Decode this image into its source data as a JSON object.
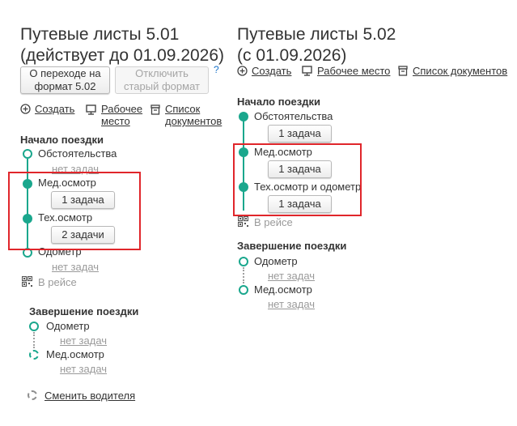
{
  "left": {
    "title_line1": "Путевые листы 5.01",
    "title_line2": "(действует до 01.09.2026)",
    "buttons": {
      "about_label": "О переходе на\nформат 5.02",
      "disable_label": "Отключить\nстарый формат",
      "help": "?"
    },
    "actions": {
      "create": "Создать",
      "workplace": "Рабочее\nместо",
      "doclist": "Список\nдокументов"
    },
    "start": {
      "heading": "Начало поездки",
      "steps": [
        {
          "label": "Обстоятельства",
          "task": "нет задач"
        },
        {
          "label": "Мед.осмотр",
          "task": "1 задача"
        },
        {
          "label": "Тех.осмотр",
          "task": "2 задачи"
        },
        {
          "label": "Одометр",
          "task": "нет задач"
        }
      ],
      "in_trip": "В рейсе"
    },
    "finish": {
      "heading": "Завершение поездки",
      "steps": [
        {
          "label": "Одометр",
          "task": "нет задач"
        },
        {
          "label": "Мед.осмотр",
          "task": "нет задач"
        }
      ]
    },
    "change_driver": "Сменить водителя"
  },
  "right": {
    "title_line1": "Путевые листы 5.02",
    "title_line2": "(с 01.09.2026)",
    "actions": {
      "create": "Создать",
      "workplace": "Рабочее место",
      "doclist": "Список документов"
    },
    "start": {
      "heading": "Начало поездки",
      "steps": [
        {
          "label": "Обстоятельства",
          "task": "1 задача"
        },
        {
          "label": "Мед.осмотр",
          "task": "1 задача"
        },
        {
          "label": "Тех.осмотр и одометр",
          "task": "1 задача"
        }
      ],
      "in_trip": "В рейсе"
    },
    "finish": {
      "heading": "Завершение поездки",
      "steps": [
        {
          "label": "Одометр",
          "task": "нет задач"
        },
        {
          "label": "Мед.осмотр",
          "task": "нет задач"
        }
      ]
    }
  },
  "colors": {
    "accent": "#1aa78d",
    "highlight": "#e0262b",
    "muted": "#9a9a9a"
  }
}
